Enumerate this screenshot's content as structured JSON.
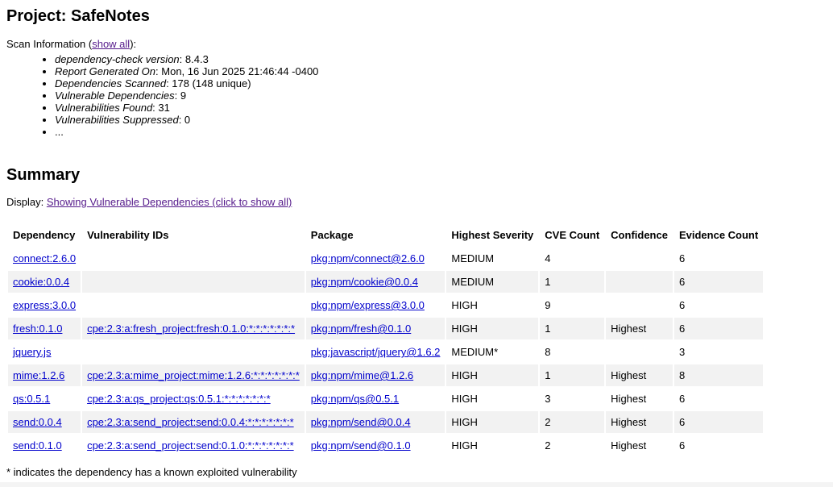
{
  "project_title": "Project: SafeNotes",
  "scan": {
    "label_prefix": "Scan Information (",
    "show_all": "show all",
    "label_suffix": "):",
    "items": [
      {
        "key": "dependency-check version",
        "value": ": 8.4.3"
      },
      {
        "key": "Report Generated On",
        "value": ": Mon, 16 Jun 2025 21:46:44 -0400"
      },
      {
        "key": "Dependencies Scanned",
        "value": ": 178 (148 unique)"
      },
      {
        "key": "Vulnerable Dependencies",
        "value": ": 9"
      },
      {
        "key": "Vulnerabilities Found",
        "value": ": 31"
      },
      {
        "key": "Vulnerabilities Suppressed",
        "value": ": 0"
      },
      {
        "key": "",
        "value": "..."
      }
    ]
  },
  "summary_title": "Summary",
  "display": {
    "label": "Display: ",
    "link": "Showing Vulnerable Dependencies (click to show all)"
  },
  "table": {
    "headers": [
      "Dependency",
      "Vulnerability IDs",
      "Package",
      "Highest Severity",
      "CVE Count",
      "Confidence",
      "Evidence Count"
    ],
    "rows": [
      {
        "dependency": "connect:2.6.0",
        "vuln_id": "",
        "package": "pkg:npm/connect@2.6.0",
        "severity": "MEDIUM",
        "cve_count": "4",
        "confidence": "",
        "evidence_count": "6"
      },
      {
        "dependency": "cookie:0.0.4",
        "vuln_id": "",
        "package": "pkg:npm/cookie@0.0.4",
        "severity": "MEDIUM",
        "cve_count": "1",
        "confidence": "",
        "evidence_count": "6"
      },
      {
        "dependency": "express:3.0.0",
        "vuln_id": "",
        "package": "pkg:npm/express@3.0.0",
        "severity": "HIGH",
        "cve_count": "9",
        "confidence": "",
        "evidence_count": "6"
      },
      {
        "dependency": "fresh:0.1.0",
        "vuln_id": "cpe:2.3:a:fresh_project:fresh:0.1.0:*:*:*:*:*:*:*",
        "package": "pkg:npm/fresh@0.1.0",
        "severity": "HIGH",
        "cve_count": "1",
        "confidence": "Highest",
        "evidence_count": "6"
      },
      {
        "dependency": "jquery.js",
        "vuln_id": "",
        "package": "pkg:javascript/jquery@1.6.2",
        "severity": "MEDIUM*",
        "cve_count": "8",
        "confidence": "",
        "evidence_count": "3"
      },
      {
        "dependency": "mime:1.2.6",
        "vuln_id": "cpe:2.3:a:mime_project:mime:1.2.6:*:*:*:*:*:*:*",
        "package": "pkg:npm/mime@1.2.6",
        "severity": "HIGH",
        "cve_count": "1",
        "confidence": "Highest",
        "evidence_count": "8"
      },
      {
        "dependency": "qs:0.5.1",
        "vuln_id": "cpe:2.3:a:qs_project:qs:0.5.1:*:*:*:*:*:*:*",
        "package": "pkg:npm/qs@0.5.1",
        "severity": "HIGH",
        "cve_count": "3",
        "confidence": "Highest",
        "evidence_count": "6"
      },
      {
        "dependency": "send:0.0.4",
        "vuln_id": "cpe:2.3:a:send_project:send:0.0.4:*:*:*:*:*:*:*",
        "package": "pkg:npm/send@0.0.4",
        "severity": "HIGH",
        "cve_count": "2",
        "confidence": "Highest",
        "evidence_count": "6"
      },
      {
        "dependency": "send:0.1.0",
        "vuln_id": "cpe:2.3:a:send_project:send:0.1.0:*:*:*:*:*:*:*",
        "package": "pkg:npm/send@0.1.0",
        "severity": "HIGH",
        "cve_count": "2",
        "confidence": "Highest",
        "evidence_count": "6"
      }
    ]
  },
  "footnote": "* indicates the dependency has a known exploited vulnerability",
  "colors": {
    "link": "#0000cc",
    "visited_link": "#551a8b",
    "row_stripe": "#f2f2f2"
  }
}
